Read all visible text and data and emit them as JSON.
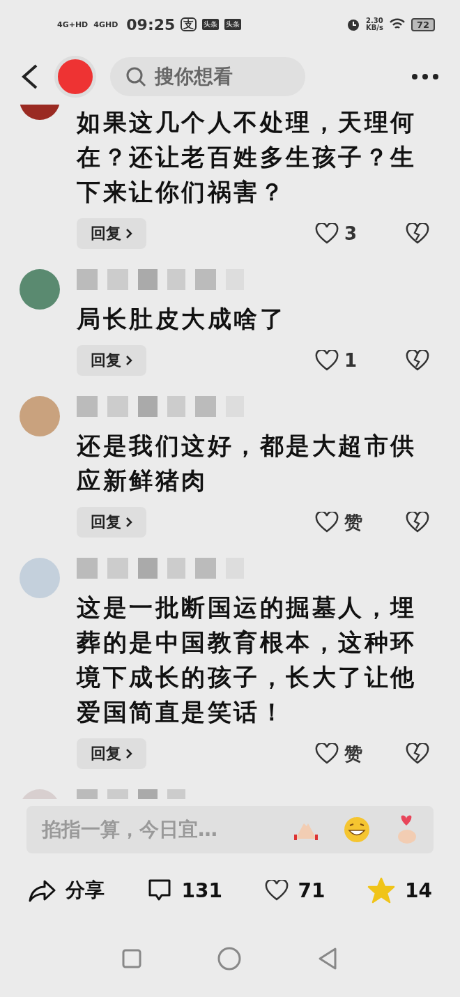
{
  "status_bar": {
    "network_1": "4G+HD",
    "network_2": "4GHD",
    "time": "09:25",
    "app_badge": "支",
    "news_badges": [
      "头条",
      "头条"
    ],
    "speed_value": "2.30",
    "speed_unit": "KB/s",
    "battery": "72"
  },
  "header": {
    "search": {
      "placeholder": "搜你想看"
    }
  },
  "comments": [
    {
      "kind": "clipped-top",
      "text": "如果这几个人不处理，天理何在？还让老百姓多生孩子？生下来让你们祸害？",
      "reply_label": "回复",
      "like_label": "3"
    },
    {
      "kind": "full",
      "text": "局长肚皮大成啥了",
      "reply_label": "回复",
      "like_label": "1"
    },
    {
      "kind": "full",
      "text": "还是我们这好，都是大超市供应新鲜猪肉",
      "reply_label": "回复",
      "like_label": "赞"
    },
    {
      "kind": "full",
      "text": "这是一批断国运的掘墓人，埋葬的是中国教育根本，这种环境下成长的孩子，长大了让他爱国简直是笑话！",
      "reply_label": "回复",
      "like_label": "赞"
    },
    {
      "kind": "clipped-bottom"
    }
  ],
  "input": {
    "placeholder": "掐指一算，今日宜…"
  },
  "bottom_bar": {
    "share_label": "分享",
    "comment_count": "131",
    "like_count": "71",
    "favorite_count": "14",
    "favorited": true
  }
}
